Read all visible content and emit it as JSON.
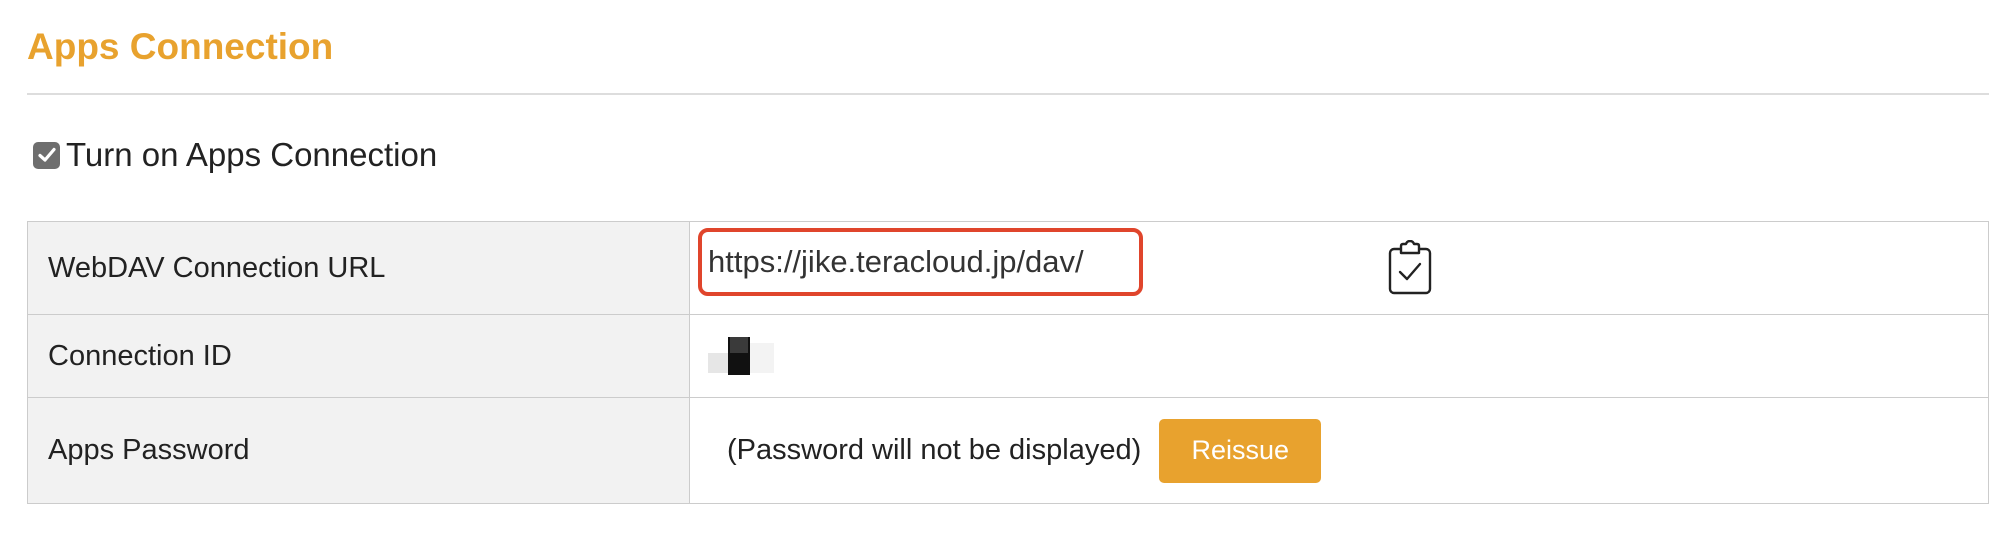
{
  "section": {
    "title": "Apps Connection"
  },
  "toggle": {
    "label": "Turn on Apps Connection",
    "checked": true
  },
  "table": {
    "rows": [
      {
        "label": "WebDAV Connection URL",
        "value": "https://jike.teracloud.jp/dav/"
      },
      {
        "label": "Connection ID",
        "value": ""
      },
      {
        "label": "Apps Password",
        "value": "(Password will not be displayed)"
      }
    ]
  },
  "actions": {
    "reissue_label": "Reissue",
    "copy_icon": "clipboard-check-icon"
  },
  "colors": {
    "accent": "#e8a22e",
    "highlight_border": "#e0452c",
    "label_bg": "#f2f2f2",
    "border": "#cccccc"
  }
}
